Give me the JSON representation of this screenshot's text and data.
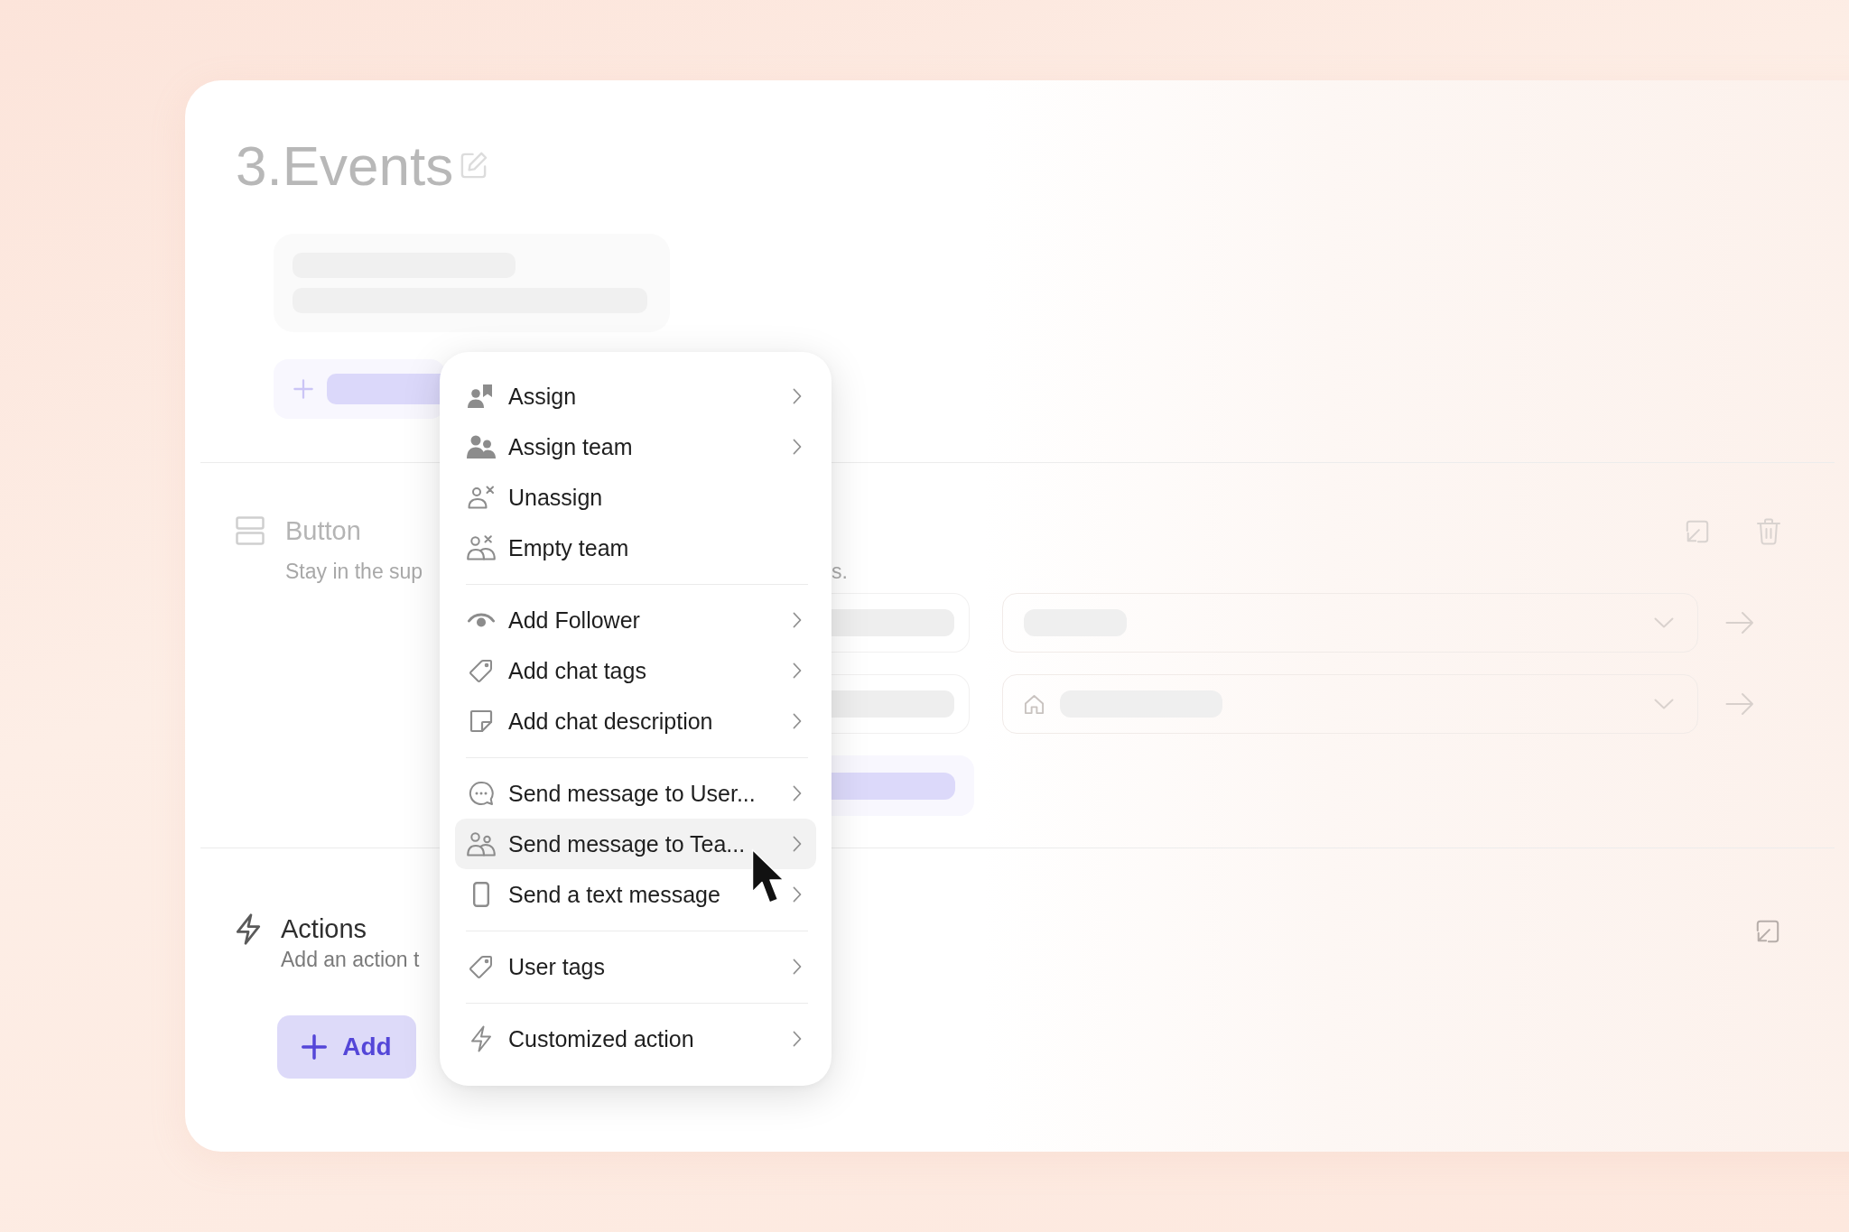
{
  "page": {
    "title": "3.Events"
  },
  "button_section": {
    "title": "Button",
    "subtitle_visible": [
      "Stay in the sup",
      "s."
    ]
  },
  "actions_section": {
    "title": "Actions",
    "subtitle": "Add an action t",
    "add_button": "Add"
  },
  "context_menu": {
    "groups": [
      {
        "items": [
          {
            "label": "Assign",
            "submenu": true,
            "selected": false
          },
          {
            "label": "Assign team",
            "submenu": true,
            "selected": false
          },
          {
            "label": "Unassign",
            "submenu": false,
            "selected": false
          },
          {
            "label": "Empty team",
            "submenu": false,
            "selected": false
          }
        ]
      },
      {
        "items": [
          {
            "label": "Add Follower",
            "submenu": true,
            "selected": false
          },
          {
            "label": "Add chat tags",
            "submenu": true,
            "selected": false
          },
          {
            "label": "Add chat description",
            "submenu": true,
            "selected": false
          }
        ]
      },
      {
        "items": [
          {
            "label": "Send message to User...",
            "submenu": true,
            "selected": false
          },
          {
            "label": "Send message to Tea...",
            "submenu": true,
            "selected": true
          },
          {
            "label": "Send a text message",
            "submenu": true,
            "selected": false
          }
        ]
      },
      {
        "items": [
          {
            "label": "User tags",
            "submenu": true,
            "selected": false
          }
        ]
      },
      {
        "items": [
          {
            "label": "Customized action",
            "submenu": true,
            "selected": false
          }
        ]
      }
    ]
  }
}
